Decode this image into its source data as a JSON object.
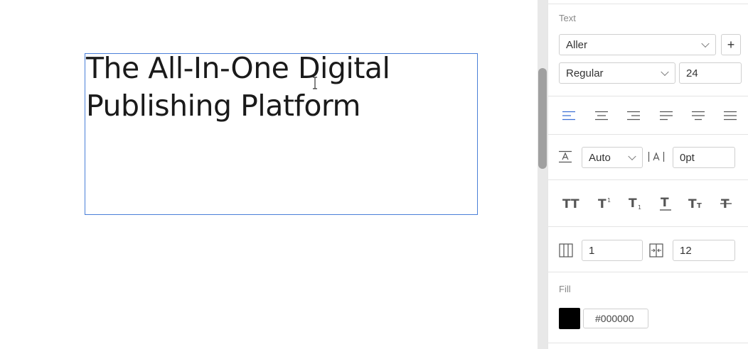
{
  "canvas": {
    "text_frame": {
      "content": "The All-In-One Digital\nPublishing Platform"
    }
  },
  "panel": {
    "text_section": {
      "label": "Text",
      "font_family": "Aller",
      "font_weight": "Regular",
      "font_size": "24",
      "add_font_button": "+"
    },
    "alignment": {
      "options": [
        "align-left",
        "align-center",
        "align-right",
        "justify-left",
        "justify-center",
        "justify-all"
      ],
      "selected": "align-left"
    },
    "spacing": {
      "line_height": "Auto",
      "letter_spacing": "0pt"
    },
    "text_styles": {
      "options": [
        "all-caps",
        "superscript",
        "subscript",
        "underline",
        "small-caps",
        "strikethrough"
      ]
    },
    "columns": {
      "count": "1",
      "gutter": "12"
    },
    "fill": {
      "label": "Fill",
      "color": "#000000",
      "hex_value": "#000000"
    }
  },
  "colors": {
    "accent": "#4a7fd8",
    "active_icon": "#3b6fd4"
  }
}
